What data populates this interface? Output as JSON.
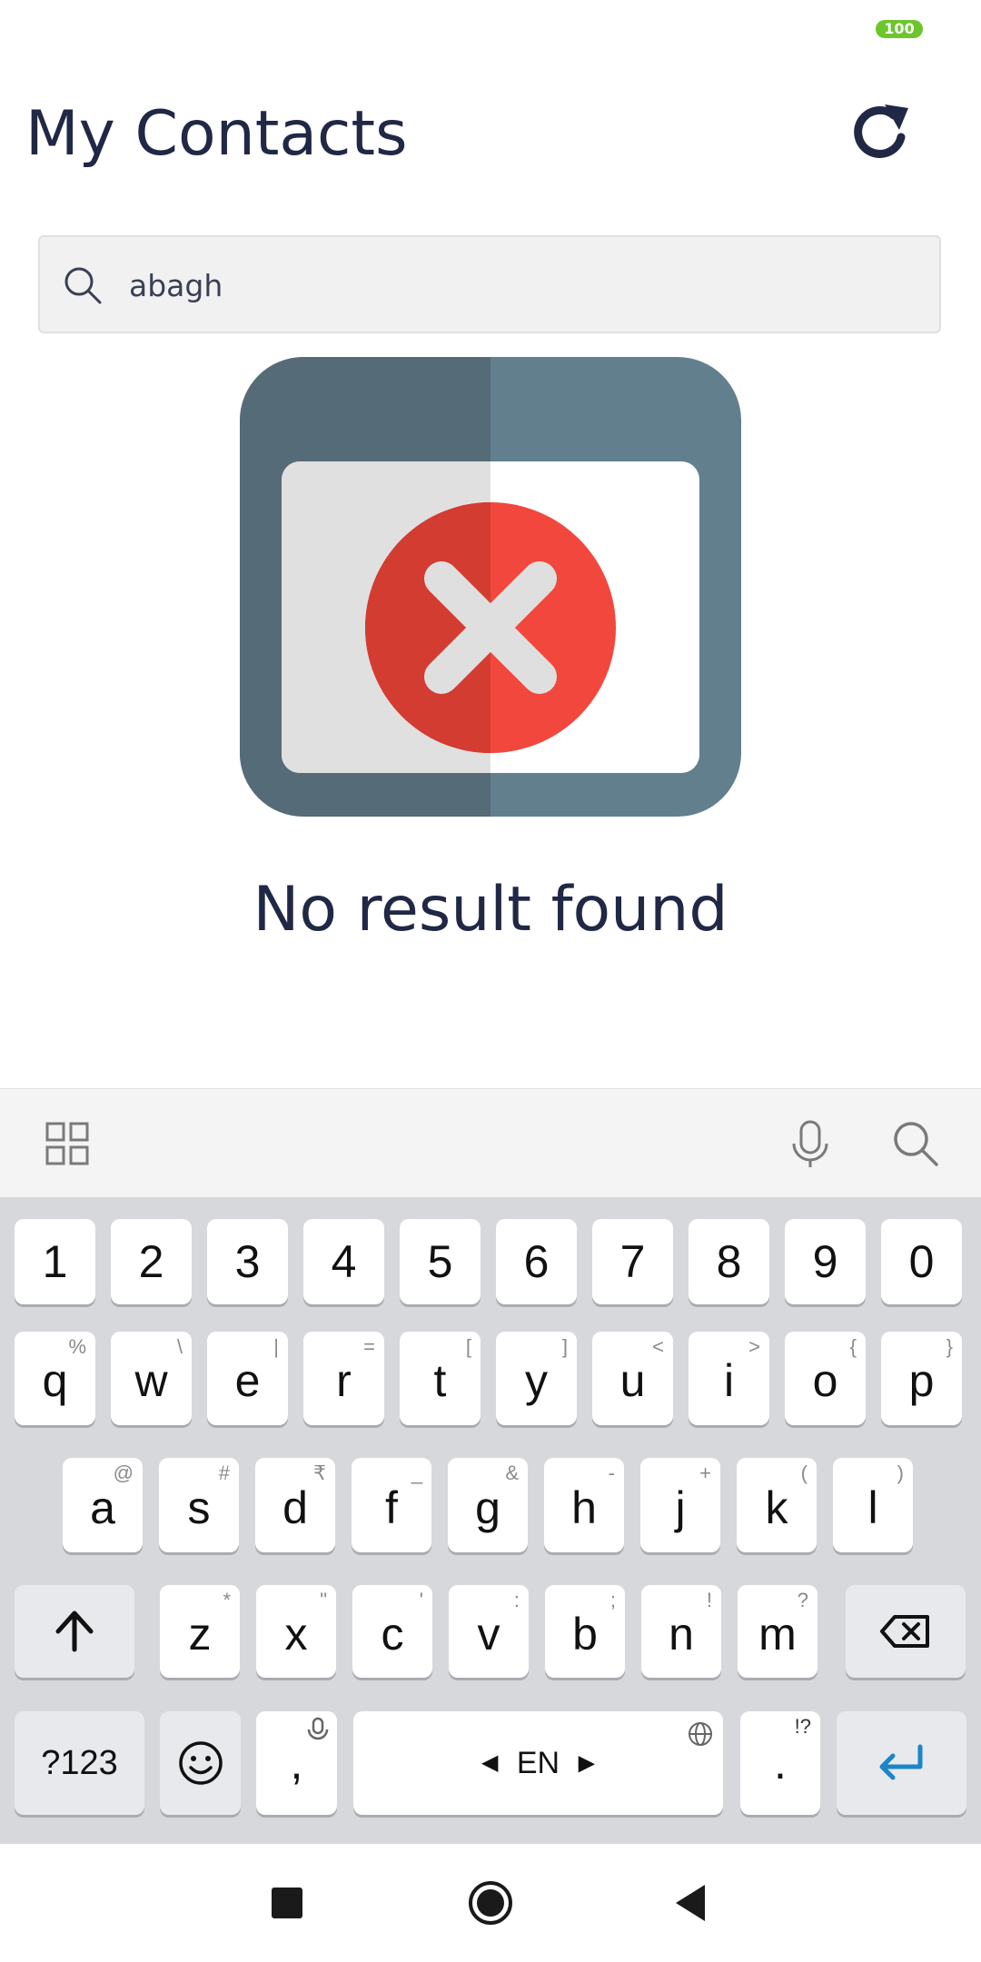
{
  "status_bar": {
    "battery": "100"
  },
  "header": {
    "title": "My Contacts",
    "refresh_icon": "refresh-icon"
  },
  "search": {
    "value": "abagh",
    "icon": "search-icon"
  },
  "empty_state": {
    "message": "No result found",
    "icon": "window-error-icon"
  },
  "keyboard": {
    "toolbar": {
      "left_icon": "grid-icon",
      "right_icons": [
        "microphone-icon",
        "search-icon"
      ]
    },
    "row1": [
      {
        "label": "1",
        "hint": ""
      },
      {
        "label": "2",
        "hint": ""
      },
      {
        "label": "3",
        "hint": ""
      },
      {
        "label": "4",
        "hint": ""
      },
      {
        "label": "5",
        "hint": ""
      },
      {
        "label": "6",
        "hint": ""
      },
      {
        "label": "7",
        "hint": ""
      },
      {
        "label": "8",
        "hint": ""
      },
      {
        "label": "9",
        "hint": ""
      },
      {
        "label": "0",
        "hint": ""
      }
    ],
    "row2": [
      {
        "label": "q",
        "hint": "%"
      },
      {
        "label": "w",
        "hint": "\\"
      },
      {
        "label": "e",
        "hint": "|"
      },
      {
        "label": "r",
        "hint": "="
      },
      {
        "label": "t",
        "hint": "["
      },
      {
        "label": "y",
        "hint": "]"
      },
      {
        "label": "u",
        "hint": "<"
      },
      {
        "label": "i",
        "hint": ">"
      },
      {
        "label": "o",
        "hint": "{"
      },
      {
        "label": "p",
        "hint": "}"
      }
    ],
    "row3": [
      {
        "label": "a",
        "hint": "@"
      },
      {
        "label": "s",
        "hint": "#"
      },
      {
        "label": "d",
        "hint": "₹"
      },
      {
        "label": "f",
        "hint": "_"
      },
      {
        "label": "g",
        "hint": "&"
      },
      {
        "label": "h",
        "hint": "-"
      },
      {
        "label": "j",
        "hint": "+"
      },
      {
        "label": "k",
        "hint": "("
      },
      {
        "label": "l",
        "hint": ")"
      }
    ],
    "row4": [
      {
        "label": "z",
        "hint": "*"
      },
      {
        "label": "x",
        "hint": "\""
      },
      {
        "label": "c",
        "hint": "'"
      },
      {
        "label": "v",
        "hint": ":"
      },
      {
        "label": "b",
        "hint": ";"
      },
      {
        "label": "n",
        "hint": "!"
      },
      {
        "label": "m",
        "hint": "?"
      }
    ],
    "shift_icon": "shift-arrow-icon",
    "backspace_icon": "backspace-icon",
    "symbols_label": "?123",
    "emoji_icon": "emoji-icon",
    "comma_label": ",",
    "space_label": "EN",
    "period_label": ".",
    "period_hint": "!?",
    "enter_icon": "enter-icon"
  },
  "nav_bar": {
    "icons": [
      "recents-square-icon",
      "home-circle-icon",
      "back-triangle-icon"
    ]
  }
}
